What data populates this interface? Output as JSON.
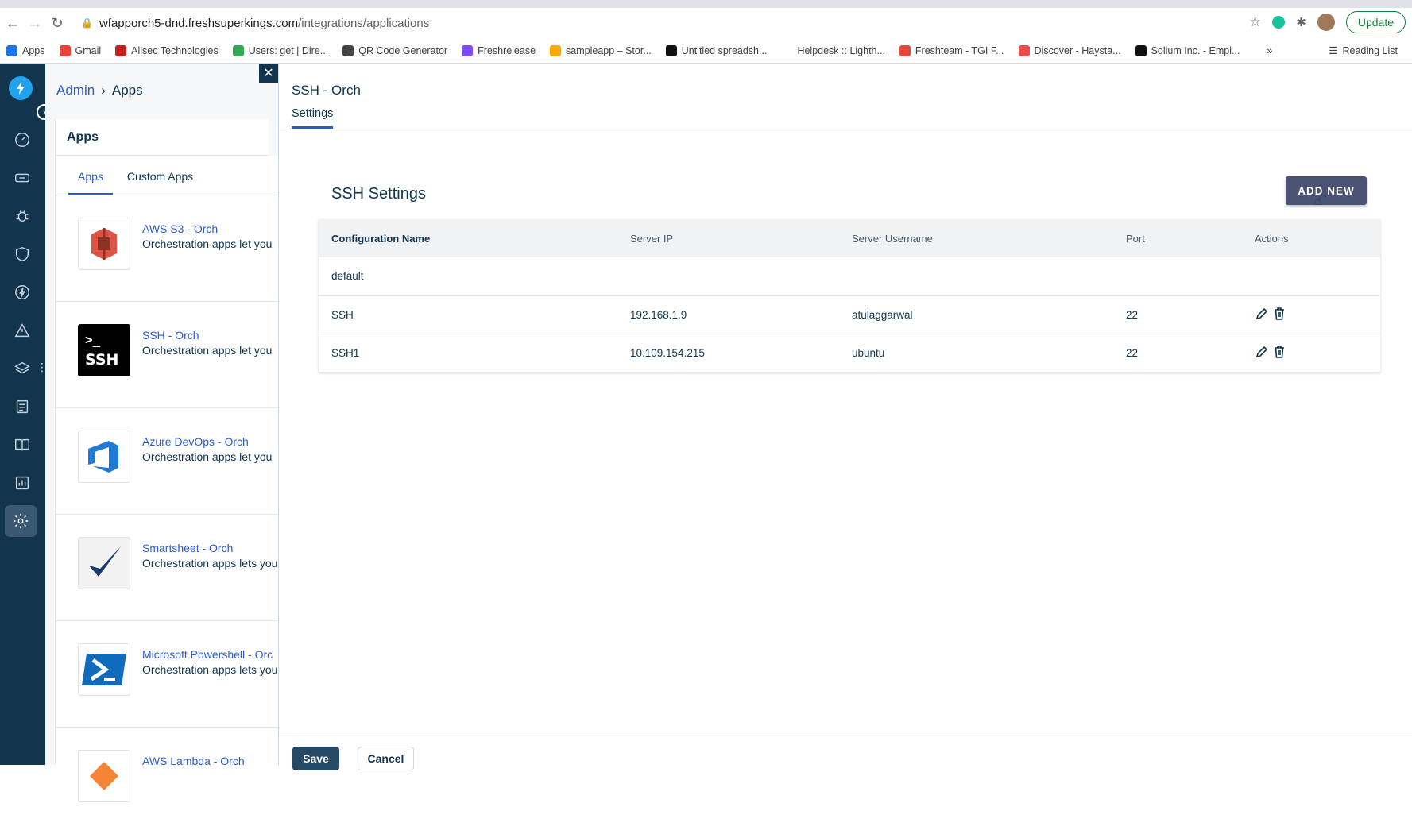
{
  "browser": {
    "url_host": "wfapporch5-dnd.freshsuperkings.com",
    "url_path": "/integrations/applications",
    "update_label": "Update",
    "bookmarks": [
      {
        "label": "Apps",
        "color": "#1a73e8"
      },
      {
        "label": "Gmail",
        "color": "#ea4335"
      },
      {
        "label": "Allsec Technologies",
        "color": "#c5221f"
      },
      {
        "label": "Users: get | Dire...",
        "color": "#34a853"
      },
      {
        "label": "QR Code Generator",
        "color": "#444444"
      },
      {
        "label": "Freshrelease",
        "color": "#7c4dff"
      },
      {
        "label": "sampleapp – Stor...",
        "color": "#f9ab00"
      },
      {
        "label": "Untitled spreadsh...",
        "color": "#111111"
      },
      {
        "label": "Helpdesk :: Lighth...",
        "color": "#ffffff"
      },
      {
        "label": "Freshteam - TGI F...",
        "color": "#e8453c"
      },
      {
        "label": "Discover - Haysta...",
        "color": "#e94d4d"
      },
      {
        "label": "Solium Inc. - Empl...",
        "color": "#111111"
      }
    ],
    "more_label": "»",
    "reading_list": "Reading List"
  },
  "breadcrumb": {
    "parent": "Admin",
    "separator": "›",
    "current": "Apps"
  },
  "apps_panel": {
    "title": "Apps",
    "tabs": [
      "Apps",
      "Custom Apps"
    ],
    "items": [
      {
        "name": "AWS S3 - Orch",
        "desc": "Orchestration apps let you"
      },
      {
        "name": "SSH - Orch",
        "desc": "Orchestration apps let you"
      },
      {
        "name": "Azure DevOps - Orch",
        "desc": "Orchestration apps let you"
      },
      {
        "name": "Smartsheet - Orch",
        "desc": "Orchestration apps lets you"
      },
      {
        "name": "Microsoft Powershell - Orc",
        "desc": "Orchestration apps lets you"
      },
      {
        "name": "AWS Lambda - Orch",
        "desc": ""
      }
    ]
  },
  "drawer": {
    "title": "SSH - Orch",
    "tab": "Settings",
    "section_title": "SSH Settings",
    "add_new_label": "ADD NEW",
    "columns": [
      "Configuration Name",
      "Server IP",
      "Server Username",
      "Port",
      "Actions"
    ],
    "rows": [
      {
        "name": "default",
        "ip": "",
        "user": "",
        "port": "",
        "actions": false
      },
      {
        "name": "SSH",
        "ip": "192.168.1.9",
        "user": "atulaggarwal",
        "port": "22",
        "actions": true
      },
      {
        "name": "SSH1",
        "ip": "10.109.154.215",
        "user": "ubuntu",
        "port": "22",
        "actions": true
      }
    ],
    "save_label": "Save",
    "cancel_label": "Cancel"
  }
}
